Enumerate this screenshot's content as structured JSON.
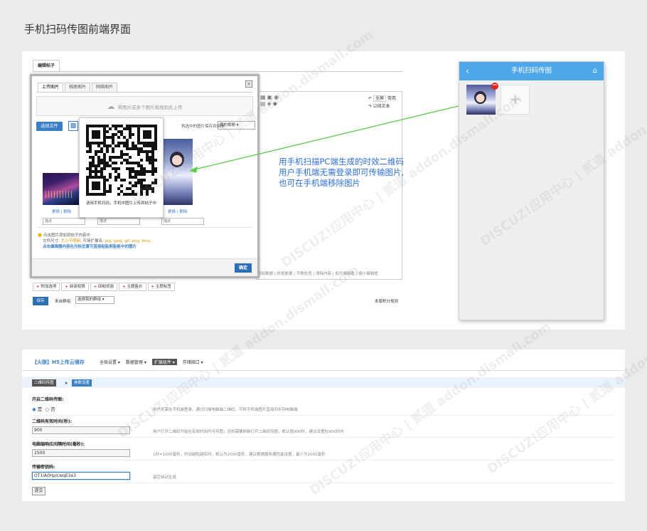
{
  "page_title": "手机扫码传图前端界面",
  "editor": {
    "post_tab": "编辑帖子",
    "dialog_tabs": [
      "上传图片",
      "相册图片",
      "网络图片"
    ],
    "drop_hint": "将图片或多个图片拖拽到此上传",
    "select_file": "选择文件",
    "album_label": "将选中的图片保存到相册:",
    "album_value": "我的相册",
    "img_links": [
      "更换",
      "删除"
    ],
    "img_links2": [
      "更换",
      "删除"
    ],
    "notes": [
      "描述",
      "描述",
      "描述"
    ],
    "tips_1": "点击图片添加到帖子内容中",
    "tips_2_prefix": "文件尺寸:",
    "tips_2_size": "大小不限制",
    "tips_2_mid": ", 可用扩展名:",
    "tips_2_ext": "jpg, jpeg, gif, png, bmp",
    "tips_3": "点击编辑器内容在光标位置可直接粘贴剪贴板中的图片",
    "ok": "确定",
    "qr_caption": "请用手机扫码，手机中图片上传到帖子中",
    "right_btns": [
      "全屏",
      "常用",
      "纯文本"
    ],
    "bottom_tabs": "添加数据 | 恢复数据 | 字数检查 | 清除内容 | 加大编辑框 | 缩小编辑框",
    "options": [
      "附加选项",
      "阅读权限",
      "回帖奖励",
      "主题售价",
      "主题标签"
    ],
    "save": "保存",
    "from_group": "来自群组:",
    "group_sel": "选择我的群组",
    "score_rule": "本版积分规则"
  },
  "annotation": [
    "用手机扫描PC端生成的时效二维码",
    "用户手机端无需登录即可传输图片,",
    "也可在手机端移除图片"
  ],
  "phone": {
    "title": "手机扫码传图",
    "back_icon": "‹",
    "home_icon": "⌂",
    "add_icon": "+"
  },
  "admin": {
    "plugin_title": "【火狼】H5上传云储存",
    "menu": [
      "全局设置 ▾",
      "数据管理 ▾",
      "扩展组件 ▾",
      "存储接口 ▾"
    ],
    "crumb1": "二维码传图",
    "crumb2": "参数设置",
    "fields": [
      {
        "label": "开启二维码传图:",
        "desc": "用户无需在手机端登录，通过扫描电脑端二维码，可将手机端图片直接同步到电脑端"
      },
      {
        "label": "二维码有效时间(秒):",
        "value": "900",
        "desc": "用户打开二维码开始在有效时间内可传图，否则需要刷新打开二维码传图，默认值900秒，建议设置在900秒内"
      },
      {
        "label": "电脑端响应间隔时间(毫秒):",
        "value": "1500",
        "desc": "1秒=1000毫秒，时间越短越实时，默认为2000毫秒，建议根据服务器性能设置，最少为1000毫秒"
      },
      {
        "label": "传输密钥码:",
        "value": "OT1iA0HpIcwqE3e3",
        "desc": "留空自动生成"
      }
    ],
    "radio_yes": "是",
    "radio_no": "否",
    "submit": "提交"
  },
  "watermark": "DISCUZ!应用中心 | 贰道 addon.dismall.com"
}
